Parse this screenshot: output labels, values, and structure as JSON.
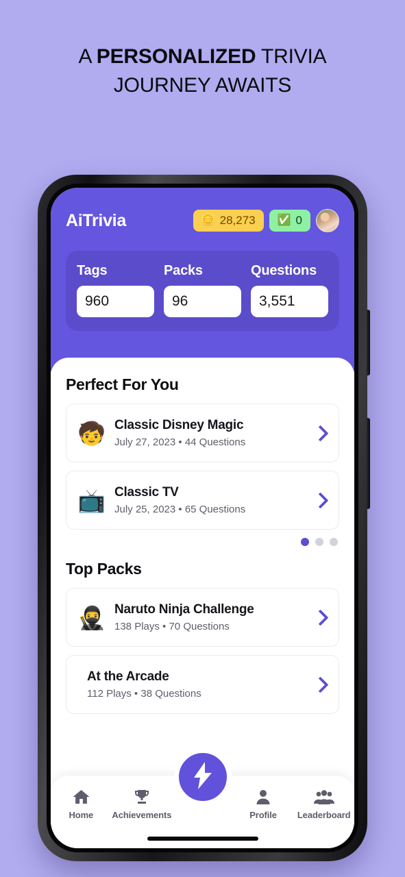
{
  "headline": {
    "line1_prefix": "A ",
    "line1_bold": "PERSONALIZED",
    "line1_suffix": " TRIVIA",
    "line2": "JOURNEY AWAITS"
  },
  "colors": {
    "page_background": "#b1abf0",
    "header_purple": "#6456de",
    "stats_panel_purple": "#5a4ccb",
    "accent_purple": "#5b4fd0",
    "coin_badge": "#fbcf4f",
    "check_badge": "#8ef0a2"
  },
  "app": {
    "title": "AiTrivia",
    "badges": {
      "coins": {
        "icon": "coin-icon",
        "value": "28,273"
      },
      "correct": {
        "icon": "check-icon",
        "value": "0"
      }
    },
    "avatar": {
      "icon": "avatar-photo"
    },
    "stats": [
      {
        "label": "Tags",
        "value": "960"
      },
      {
        "label": "Packs",
        "value": "96"
      },
      {
        "label": "Questions",
        "value": "3,551"
      }
    ]
  },
  "sections": [
    {
      "title": "Perfect For You",
      "cards": [
        {
          "emoji": "🧒",
          "name": "Classic Disney Magic",
          "meta": "July 27, 2023 • 44 Questions",
          "chevron": "chevron-right-icon"
        },
        {
          "emoji": "📺",
          "name": "Classic TV",
          "meta": "July 25, 2023 • 65 Questions",
          "chevron": "chevron-right-icon"
        }
      ],
      "pagination": {
        "total": 3,
        "active": 0
      }
    },
    {
      "title": "Top Packs",
      "cards": [
        {
          "emoji": "🥷",
          "name": "Naruto Ninja Challenge",
          "meta": "138 Plays • 70 Questions",
          "chevron": "chevron-right-icon"
        },
        {
          "emoji": "",
          "name": "At the Arcade",
          "meta": "112 Plays • 38 Questions",
          "chevron": "chevron-right-icon"
        }
      ]
    }
  ],
  "bottom_nav": {
    "items": [
      {
        "icon": "home-icon",
        "label": "Home"
      },
      {
        "icon": "trophy-icon",
        "label": "Achievements"
      },
      {
        "icon": "person-icon",
        "label": "Profile"
      },
      {
        "icon": "group-icon",
        "label": "Leaderboard"
      }
    ],
    "fab": {
      "icon": "lightning-bolt-icon"
    }
  }
}
